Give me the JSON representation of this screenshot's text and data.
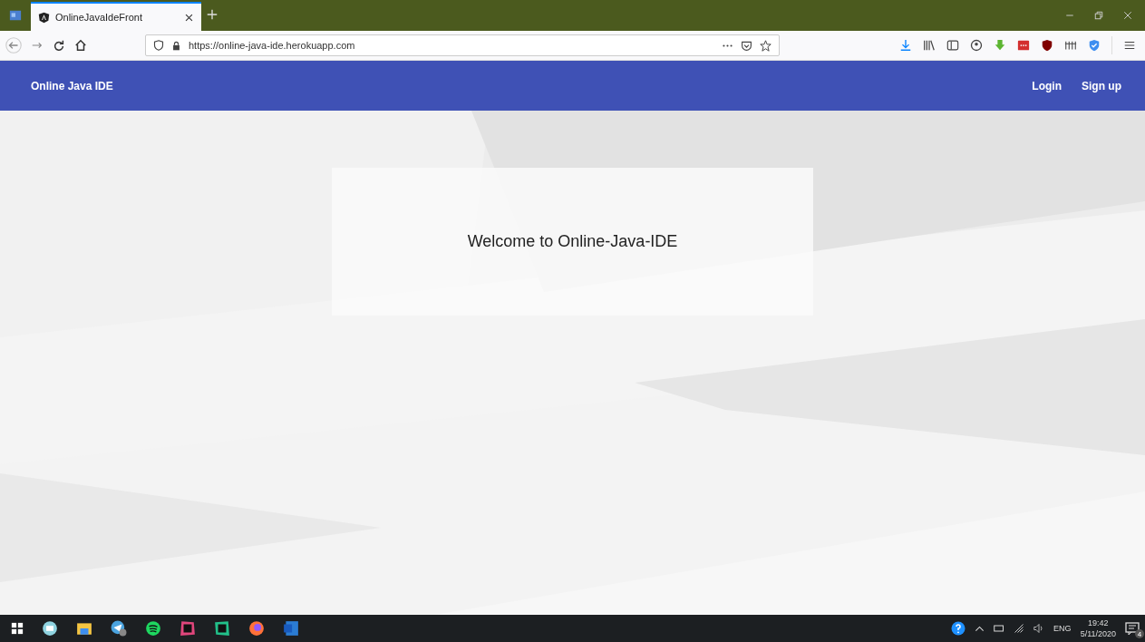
{
  "browser": {
    "tab": {
      "title": "OnlineJavaIdeFront",
      "selected": true
    },
    "url": "https://online-java-ide.herokuapp.com"
  },
  "app_bar": {
    "brand": "Online Java IDE",
    "links": [
      "Login",
      "Sign up"
    ]
  },
  "card": {
    "text": "Welcome to Online-Java-IDE"
  },
  "taskbar": {
    "language": "ENG",
    "time": "19:42",
    "date": "5/11/2020",
    "notification_count": "4"
  }
}
